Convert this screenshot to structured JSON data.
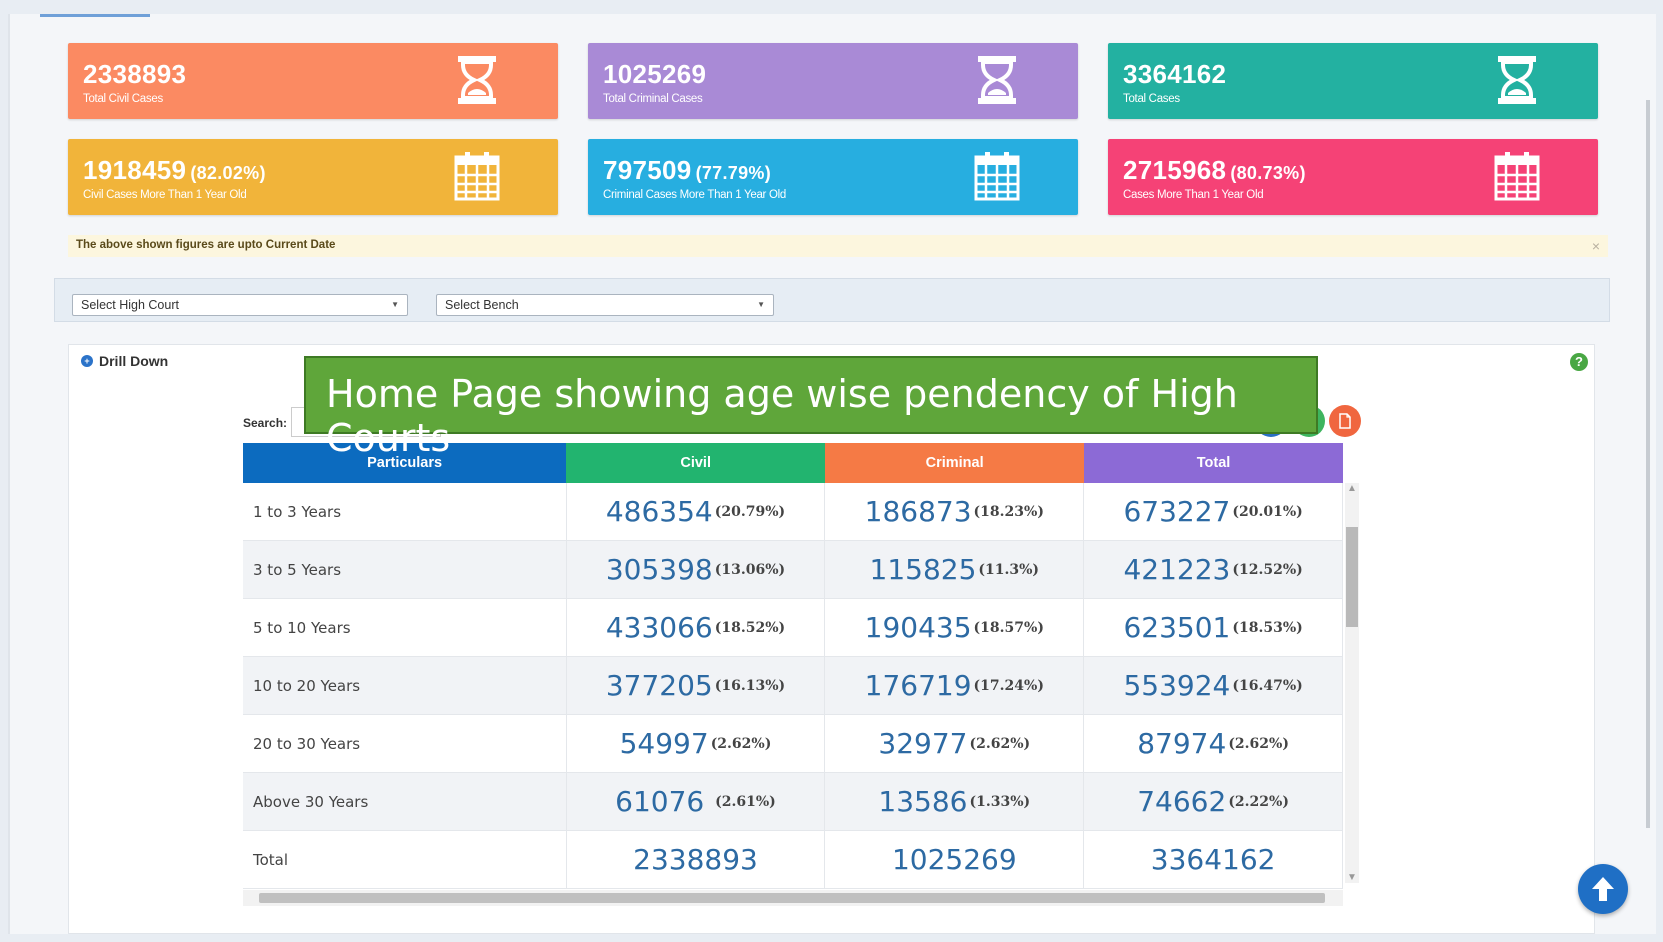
{
  "stats": [
    {
      "number": "2338893",
      "percent": "",
      "label": "Total Civil Cases",
      "color": "#fb8a62",
      "icon": "hourglass-icon"
    },
    {
      "number": "1025269",
      "percent": "",
      "label": "Total Criminal Cases",
      "color": "#a98ad6",
      "icon": "hourglass-icon"
    },
    {
      "number": "3364162",
      "percent": "",
      "label": "Total Cases",
      "color": "#23b1a1",
      "icon": "hourglass-icon"
    },
    {
      "number": "1918459",
      "percent": "(82.02%)",
      "label": "Civil Cases More Than 1 Year Old",
      "color": "#f1b43a",
      "icon": "calendar-icon"
    },
    {
      "number": "797509",
      "percent": "(77.79%)",
      "label": "Criminal Cases More Than 1 Year Old",
      "color": "#27aee0",
      "icon": "calendar-icon"
    },
    {
      "number": "2715968",
      "percent": "(80.73%)",
      "label": "Cases More Than 1 Year Old",
      "color": "#f54276",
      "icon": "calendar-icon"
    }
  ],
  "notice": {
    "text": "The above shown figures are upto Current Date",
    "close": "×"
  },
  "filters": {
    "high_court": "Select High Court",
    "bench": "Select Bench"
  },
  "drill": {
    "title": "Drill Down",
    "search_label": "Search:"
  },
  "banner": "Home Page showing age wise pendency of High Courts",
  "table": {
    "headers": [
      "Particulars",
      "Civil",
      "Criminal",
      "Total"
    ],
    "header_colors": [
      "#0c6bbf",
      "#22b46f",
      "#f57a45",
      "#8c6ad6"
    ],
    "rows": [
      {
        "label": "1 to 3 Years",
        "civil": "486354",
        "civil_pct": "(20.79%)",
        "criminal": "186873",
        "criminal_pct": "(18.23%)",
        "total": "673227",
        "total_pct": "(20.01%)"
      },
      {
        "label": "3 to 5 Years",
        "civil": "305398",
        "civil_pct": "(13.06%)",
        "criminal": "115825",
        "criminal_pct": "(11.3%)",
        "total": "421223",
        "total_pct": "(12.52%)"
      },
      {
        "label": "5 to 10 Years",
        "civil": "433066",
        "civil_pct": "(18.52%)",
        "criminal": "190435",
        "criminal_pct": "(18.57%)",
        "total": "623501",
        "total_pct": "(18.53%)"
      },
      {
        "label": "10 to 20 Years",
        "civil": "377205",
        "civil_pct": "(16.13%)",
        "criminal": "176719",
        "criminal_pct": "(17.24%)",
        "total": "553924",
        "total_pct": "(16.47%)"
      },
      {
        "label": "20 to 30 Years",
        "civil": "54997",
        "civil_pct": "(2.62%)",
        "criminal": "32977",
        "criminal_pct": "(2.62%)",
        "total": "87974",
        "total_pct": "(2.62%)"
      },
      {
        "label": "Above 30 Years",
        "civil": "61076 ",
        "civil_pct": "(2.61%)",
        "criminal": "13586",
        "criminal_pct": "(1.33%)",
        "total": "74662",
        "total_pct": "(2.22%)"
      },
      {
        "label": "Total",
        "civil": "2338893",
        "civil_pct": "",
        "criminal": "1025269",
        "criminal_pct": "",
        "total": "3364162",
        "total_pct": ""
      }
    ]
  },
  "export_buttons": [
    {
      "icon": "pdf-icon",
      "color": "#2a6fc4"
    },
    {
      "icon": "excel-icon",
      "color": "#3eb55f"
    },
    {
      "icon": "file-icon",
      "color": "#f0663f"
    }
  ]
}
